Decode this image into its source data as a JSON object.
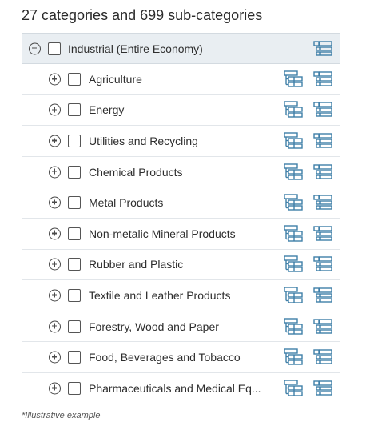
{
  "heading": "27 categories and 699 sub-categories",
  "root": {
    "label": "Industrial (Entire Economy)",
    "expanded": true,
    "icon": "list-tree-icon"
  },
  "children": [
    {
      "label": "Agriculture"
    },
    {
      "label": "Energy"
    },
    {
      "label": "Utilities and Recycling"
    },
    {
      "label": "Chemical Products"
    },
    {
      "label": "Metal Products"
    },
    {
      "label": "Non-metalic Mineral Products"
    },
    {
      "label": "Rubber and Plastic"
    },
    {
      "label": "Textile and Leather Products"
    },
    {
      "label": "Forestry, Wood and Paper"
    },
    {
      "label": "Food, Beverages and Tobacco"
    },
    {
      "label": "Pharmaceuticals and Medical Eq..."
    }
  ],
  "footnote": "*Illustrative example",
  "colors": {
    "accent": "#3f7fa8",
    "root_bg": "#e9eef2",
    "divider": "#e2e6ea"
  }
}
